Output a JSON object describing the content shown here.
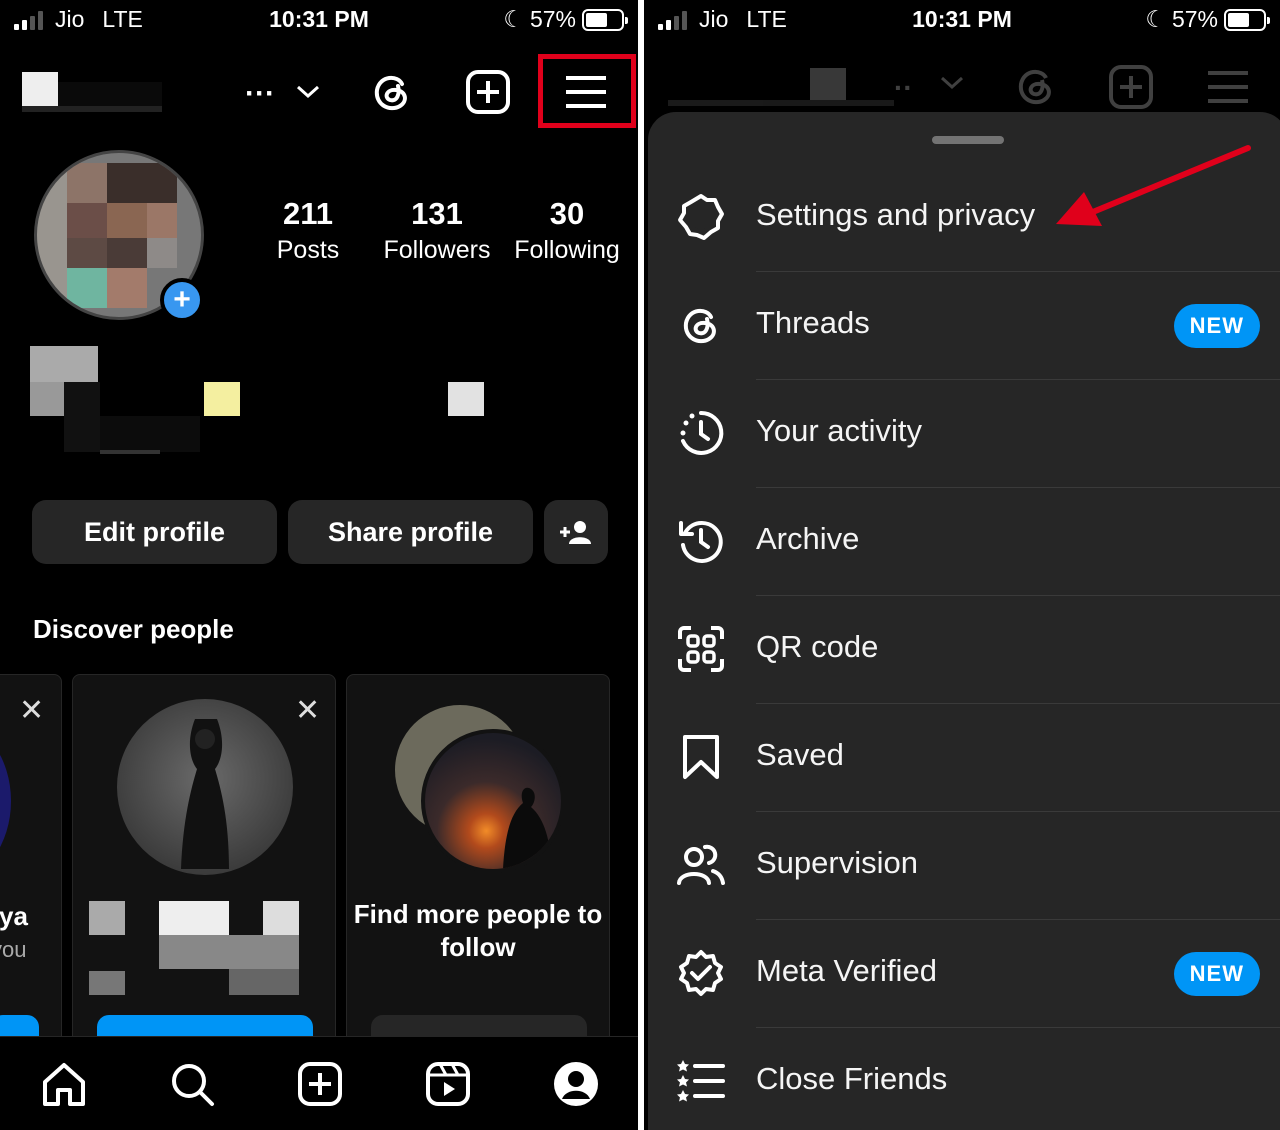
{
  "status": {
    "carrier": "Jio",
    "network": "LTE",
    "time": "10:31 PM",
    "battery": "57%"
  },
  "profile": {
    "stats": [
      {
        "value": "211",
        "label": "Posts"
      },
      {
        "value": "131",
        "label": "Followers"
      },
      {
        "value": "30",
        "label": "Following"
      }
    ],
    "edit_label": "Edit profile",
    "share_label": "Share profile"
  },
  "discover": {
    "title": "Discover people",
    "card_left_text_1": "ya",
    "card_left_text_2": "you",
    "find_more": "Find more people to follow"
  },
  "menu": {
    "items": [
      {
        "label": "Settings and privacy",
        "icon": "gear-icon"
      },
      {
        "label": "Threads",
        "icon": "threads-icon",
        "badge": "NEW"
      },
      {
        "label": "Your activity",
        "icon": "activity-icon"
      },
      {
        "label": "Archive",
        "icon": "archive-icon"
      },
      {
        "label": "QR code",
        "icon": "qr-code-icon"
      },
      {
        "label": "Saved",
        "icon": "bookmark-icon"
      },
      {
        "label": "Supervision",
        "icon": "supervision-icon"
      },
      {
        "label": "Meta Verified",
        "icon": "verified-icon",
        "badge": "NEW"
      },
      {
        "label": "Close Friends",
        "icon": "close-friends-icon"
      }
    ]
  },
  "colors": {
    "highlight": "#e0001b",
    "badge": "#0095f6",
    "sheet": "#262626"
  }
}
